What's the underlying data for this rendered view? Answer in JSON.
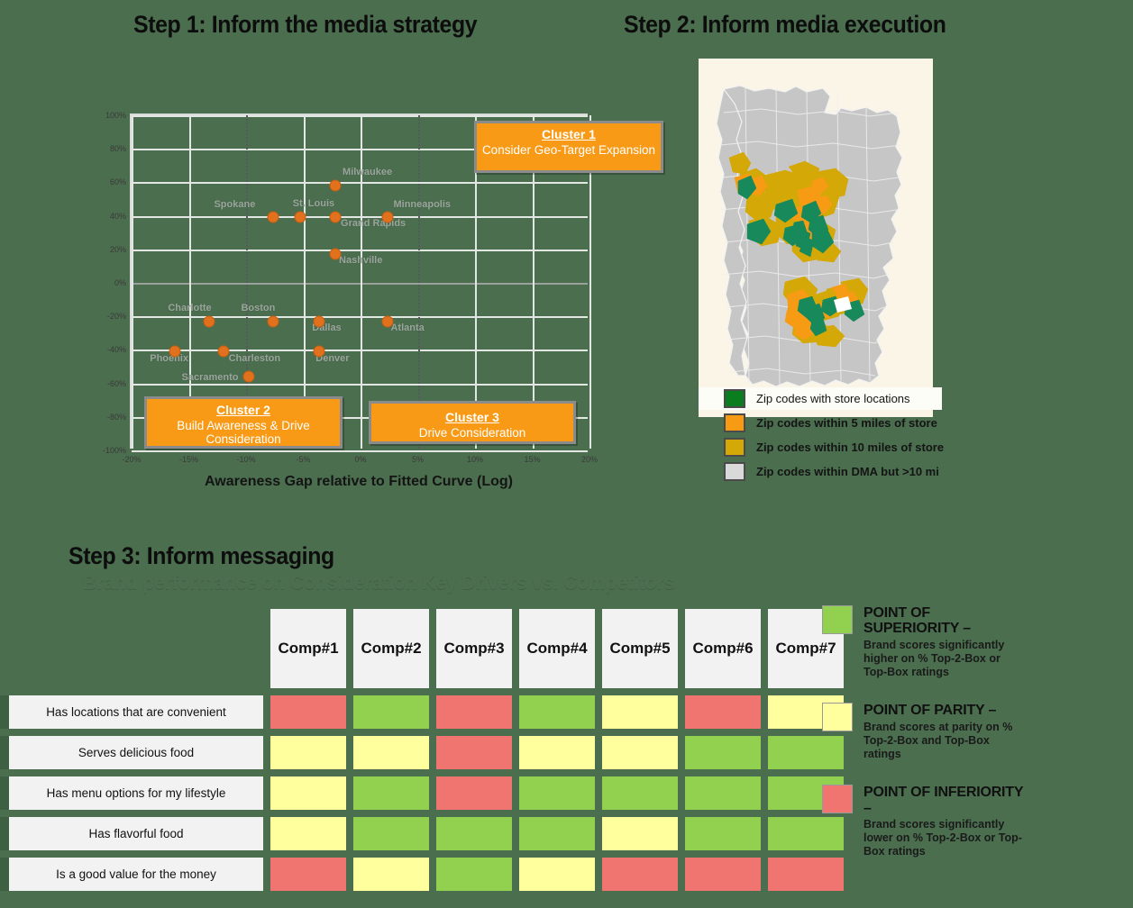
{
  "steps": {
    "step1_title": "Step 1: Inform the media strategy",
    "step2_title": "Step 2: Inform media execution",
    "step3_title": "Step 3: Inform messaging",
    "step3_subtitle": "Brand performance on Consideration Key Drivers vs. Competitors"
  },
  "chart_data": {
    "type": "scatter",
    "title": "Step 1: Inform the media strategy",
    "xlabel": "Awareness Gap relative to Fitted Curve (Log)",
    "ylabel": "",
    "xlim": [
      -20,
      20
    ],
    "ylim": [
      -100,
      100
    ],
    "xticks": [
      "-20%",
      "-15%",
      "-10%",
      "-5%",
      "0%",
      "5%",
      "10%",
      "15%",
      "20%"
    ],
    "xtick_values": [
      -20,
      -15,
      -10,
      -5,
      0,
      5,
      10,
      15,
      20
    ],
    "yticks": [
      "100%",
      "80%",
      "60%",
      "40%",
      "20%",
      "0%",
      "-20%",
      "-40%",
      "-60%",
      "-80%",
      "-100%"
    ],
    "ytick_values": [
      100,
      80,
      60,
      40,
      20,
      0,
      -20,
      -40,
      -60,
      -80,
      -100
    ],
    "grid": true,
    "legend": "none",
    "points": [
      {
        "label": "Milwaukee",
        "x": -2.2,
        "y": 58,
        "label_dx": 8,
        "label_dy": -14
      },
      {
        "label": "Spokane",
        "x": -7.6,
        "y": 39,
        "label_dx": -66,
        "label_dy": -13
      },
      {
        "label": "St. Louis",
        "x": -5.3,
        "y": 39,
        "label_dx": -8,
        "label_dy": -14
      },
      {
        "label": "Grand Rapids",
        "x": -2.2,
        "y": 39,
        "label_dx": 6,
        "label_dy": 8
      },
      {
        "label": "Minneapolis",
        "x": 2.4,
        "y": 39,
        "label_dx": 6,
        "label_dy": -13
      },
      {
        "label": "Nashville",
        "x": -2.2,
        "y": 17,
        "label_dx": 4,
        "label_dy": 8
      },
      {
        "label": "Charlotte",
        "x": -13.2,
        "y": -23,
        "label_dx": -46,
        "label_dy": -14
      },
      {
        "label": "Boston",
        "x": -7.6,
        "y": -23,
        "label_dx": -36,
        "label_dy": -14
      },
      {
        "label": "Dallas",
        "x": -3.6,
        "y": -23,
        "label_dx": -8,
        "label_dy": 8
      },
      {
        "label": "Atlanta",
        "x": 2.4,
        "y": -23,
        "label_dx": 3,
        "label_dy": 8
      },
      {
        "label": "Phoenix",
        "x": -16.2,
        "y": -41,
        "label_dx": -28,
        "label_dy": 9
      },
      {
        "label": "Charleston",
        "x": -12.0,
        "y": -41,
        "label_dx": 6,
        "label_dy": 9
      },
      {
        "label": "Denver",
        "x": -3.6,
        "y": -41,
        "label_dx": -4,
        "label_dy": 9
      },
      {
        "label": "Sacramento",
        "x": -9.8,
        "y": -56,
        "label_dx": -74,
        "label_dy": 2
      }
    ],
    "clusters": [
      {
        "id": "cluster-1",
        "title": "Cluster 1",
        "text": "Consider Geo-Target Expansion"
      },
      {
        "id": "cluster-2",
        "title": "Cluster 2",
        "text": "Build Awareness & Drive Consideration"
      },
      {
        "id": "cluster-3",
        "title": "Cluster 3",
        "text": "Drive Consideration"
      }
    ]
  },
  "map": {
    "legend": [
      {
        "label": "Zip codes with store locations",
        "color": "#0a7d1e"
      },
      {
        "label": "Zip codes within  5 miles of store",
        "color": "#f79b14"
      },
      {
        "label": "Zip codes within  10 miles of store",
        "color": "#d4a806"
      },
      {
        "label": "Zip codes within  DMA but >10 mi",
        "color": "#d9d9d9"
      }
    ]
  },
  "matrix": {
    "columns": [
      "Comp\n#1",
      "Comp\n#2",
      "Comp\n#3",
      "Comp\n#4",
      "Comp\n#5",
      "Comp\n#6",
      "Comp\n#7"
    ],
    "columns_flat": [
      "Comp #1",
      "Comp #2",
      "Comp #3",
      "Comp #4",
      "Comp #5",
      "Comp #6",
      "Comp #7"
    ],
    "rows": [
      {
        "label": "Has locations that are convenient",
        "values": [
          "inferiority",
          "superiority",
          "inferiority",
          "superiority",
          "parity",
          "inferiority",
          "parity"
        ]
      },
      {
        "label": "Serves delicious food",
        "values": [
          "parity",
          "parity",
          "inferiority",
          "parity",
          "parity",
          "superiority",
          "superiority"
        ]
      },
      {
        "label": "Has menu options for my lifestyle",
        "values": [
          "parity",
          "superiority",
          "inferiority",
          "superiority",
          "superiority",
          "superiority",
          "superiority"
        ]
      },
      {
        "label": "Has flavorful food",
        "values": [
          "parity",
          "superiority",
          "superiority",
          "superiority",
          "parity",
          "superiority",
          "superiority"
        ]
      },
      {
        "label": "Is a good value for the money",
        "values": [
          "inferiority",
          "parity",
          "superiority",
          "parity",
          "inferiority",
          "inferiority",
          "inferiority"
        ]
      }
    ],
    "colors": {
      "superiority": "#92d050",
      "parity": "#ffff9e",
      "inferiority": "#f07470"
    }
  },
  "legend": {
    "items": [
      {
        "key": "superiority",
        "head": "POINT OF SUPERIORITY –",
        "body": "Brand scores significantly higher on % Top-2-Box or Top-Box ratings",
        "color": "#92d050"
      },
      {
        "key": "parity",
        "head": "POINT OF PARITY –",
        "body": "Brand scores at parity on % Top-2-Box and Top-Box ratings",
        "color": "#ffff9e"
      },
      {
        "key": "inferiority",
        "head": "POINT OF INFERIORITY –",
        "body": "Brand scores significantly lower on % Top-2-Box or Top-Box ratings",
        "color": "#f07470"
      }
    ]
  },
  "theme": {
    "background": "#4b6e4f",
    "accent_orange": "#f89a16",
    "dot_color": "#e2711d"
  }
}
